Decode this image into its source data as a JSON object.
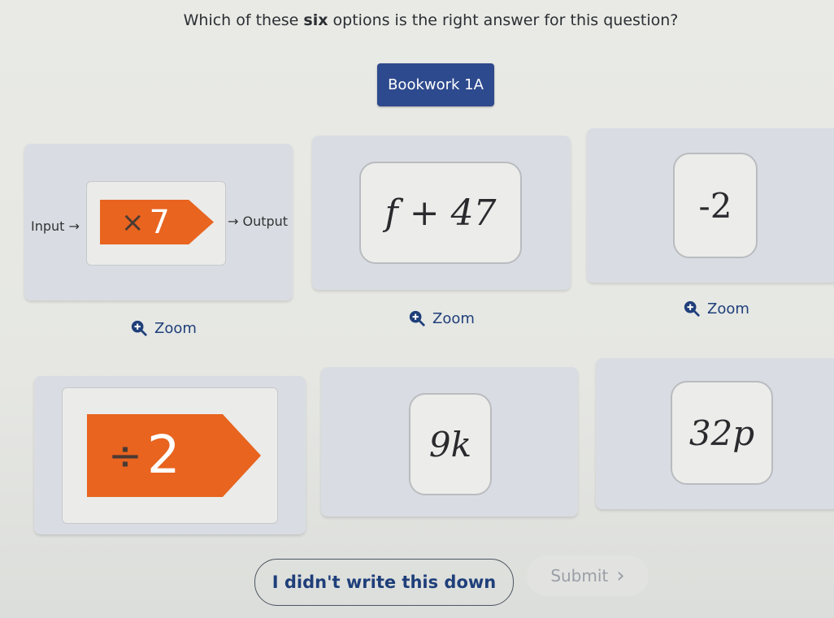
{
  "question": {
    "prefix": "Which of these ",
    "emphasis": "six",
    "suffix": " options is the right answer for this question?"
  },
  "bookwork_label": "Bookwork 1A",
  "options": [
    {
      "type": "function-machine",
      "input_label": "Input →",
      "operator": "×",
      "operand": "7",
      "output_label": "→ Output",
      "zoom_label": "Zoom"
    },
    {
      "type": "expression",
      "value": "f + 47",
      "zoom_label": "Zoom"
    },
    {
      "type": "expression",
      "value": "-2",
      "zoom_label": "Zoom"
    },
    {
      "type": "operation-tag",
      "operator": "÷",
      "operand": "2"
    },
    {
      "type": "expression",
      "value": "9k"
    },
    {
      "type": "expression",
      "value": "32p"
    }
  ],
  "actions": {
    "didnt_write_label": "I didn't write this down",
    "submit_label": "Submit",
    "submit_chevron": "›"
  },
  "colors": {
    "accent_blue": "#2e4a8e",
    "tag_orange": "#e8641f",
    "link_blue": "#1f3f7a"
  }
}
